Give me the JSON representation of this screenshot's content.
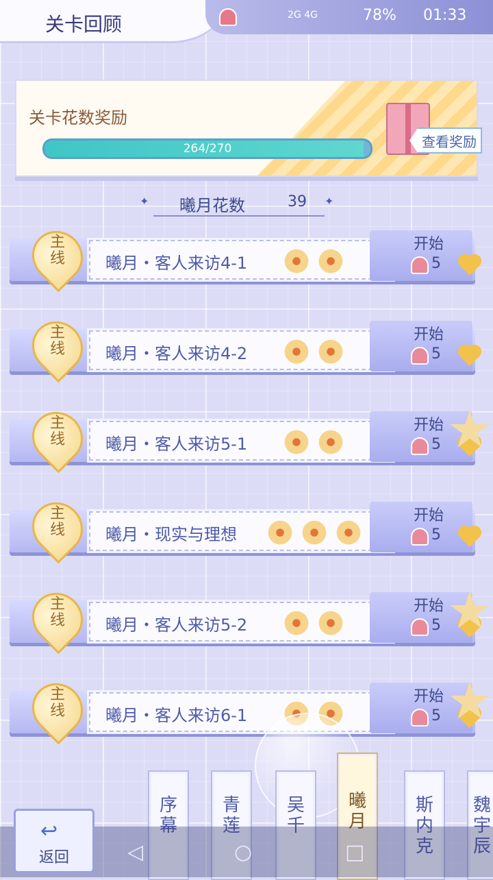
{
  "header": {
    "title": "关卡回顾"
  },
  "status_bar": {
    "battery": "78%",
    "time": "01:33",
    "network": "2G 4G"
  },
  "reward_panel": {
    "title": "关卡花数奖励",
    "progress_text": "264/270",
    "progress_fraction": 0.978,
    "view_button": "查看奖励"
  },
  "flower_count": {
    "label": "曦月花数",
    "value": "39"
  },
  "levels": [
    {
      "badge": "主线",
      "name": "曦月・客人来访4-1",
      "flowers": 2,
      "start": "开始",
      "cost": "5",
      "has_star": false
    },
    {
      "badge": "主线",
      "name": "曦月・客人来访4-2",
      "flowers": 2,
      "start": "开始",
      "cost": "5",
      "has_star": false
    },
    {
      "badge": "主线",
      "name": "曦月・客人来访5-1",
      "flowers": 2,
      "start": "开始",
      "cost": "5",
      "has_star": true
    },
    {
      "badge": "主线",
      "name": "曦月・现实与理想",
      "flowers": 3,
      "start": "开始",
      "cost": "5",
      "has_star": false
    },
    {
      "badge": "主线",
      "name": "曦月・客人来访5-2",
      "flowers": 2,
      "start": "开始",
      "cost": "5",
      "has_star": true
    },
    {
      "badge": "主线",
      "name": "曦月・客人来访6-1",
      "flowers": 2,
      "start": "开始",
      "cost": "5",
      "has_star": true
    }
  ],
  "tabs": [
    {
      "label": "序\n幕",
      "active": false
    },
    {
      "label": "青\n莲",
      "active": false
    },
    {
      "label": "吴\n千",
      "active": false
    },
    {
      "label": "曦\n月",
      "active": true
    },
    {
      "label": "斯\n内\n克",
      "active": false
    },
    {
      "label": "魏\n宇\n辰",
      "active": false
    }
  ],
  "back_button": {
    "label": "返回"
  },
  "icons": {
    "nav_back": "triangle-back-icon",
    "nav_home": "circle-home-icon",
    "nav_recent": "square-recent-icon"
  },
  "colors": {
    "accent": "#4f5aa8",
    "progress": "#3fc6c6",
    "badge": "#f6d88c"
  }
}
